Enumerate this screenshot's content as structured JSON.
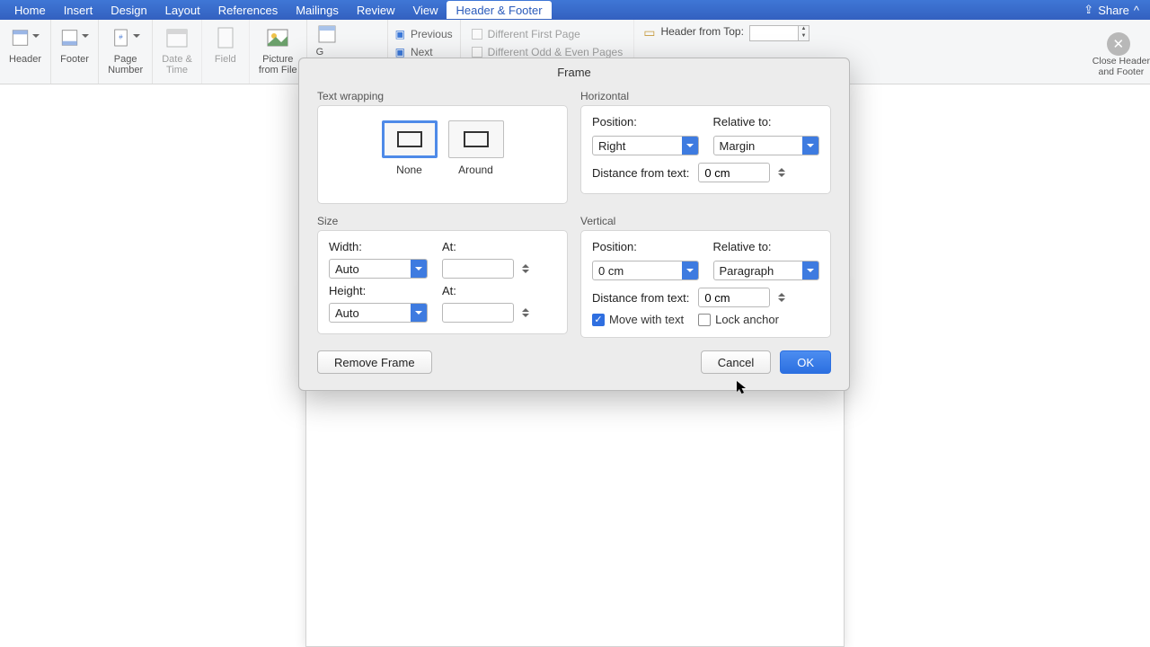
{
  "tabs": {
    "home": "Home",
    "insert": "Insert",
    "design": "Design",
    "layout": "Layout",
    "references": "References",
    "mailings": "Mailings",
    "review": "Review",
    "view": "View",
    "headerfooter": "Header & Footer",
    "share": "Share"
  },
  "ribbon": {
    "header": "Header",
    "footer": "Footer",
    "page_number": "Page\nNumber",
    "date_time": "Date &\nTime",
    "field": "Field",
    "picture_from_file": "Picture\nfrom File",
    "previous": "Previous",
    "next": "Next",
    "diff_first": "Different First Page",
    "diff_odd_even": "Different Odd & Even Pages",
    "header_from_top": "Header from Top:",
    "header_from_top_val": "",
    "close": "Close Header\nand Footer"
  },
  "dialog": {
    "title": "Frame",
    "text_wrapping_label": "Text wrapping",
    "wrap_none": "None",
    "wrap_around": "Around",
    "size_label": "Size",
    "width_label": "Width:",
    "width_val": "Auto",
    "width_at_label": "At:",
    "width_at_val": "",
    "height_label": "Height:",
    "height_val": "Auto",
    "height_at_label": "At:",
    "height_at_val": "",
    "horizontal_label": "Horizontal",
    "h_position_label": "Position:",
    "h_position_val": "Right",
    "h_relative_label": "Relative to:",
    "h_relative_val": "Margin",
    "h_distance_label": "Distance from text:",
    "h_distance_val": "0 cm",
    "vertical_label": "Vertical",
    "v_position_label": "Position:",
    "v_position_val": "0 cm",
    "v_relative_label": "Relative to:",
    "v_relative_val": "Paragraph",
    "v_distance_label": "Distance from text:",
    "v_distance_val": "0 cm",
    "move_with_text": "Move with text",
    "lock_anchor": "Lock anchor",
    "remove_frame": "Remove Frame",
    "cancel": "Cancel",
    "ok": "OK"
  }
}
